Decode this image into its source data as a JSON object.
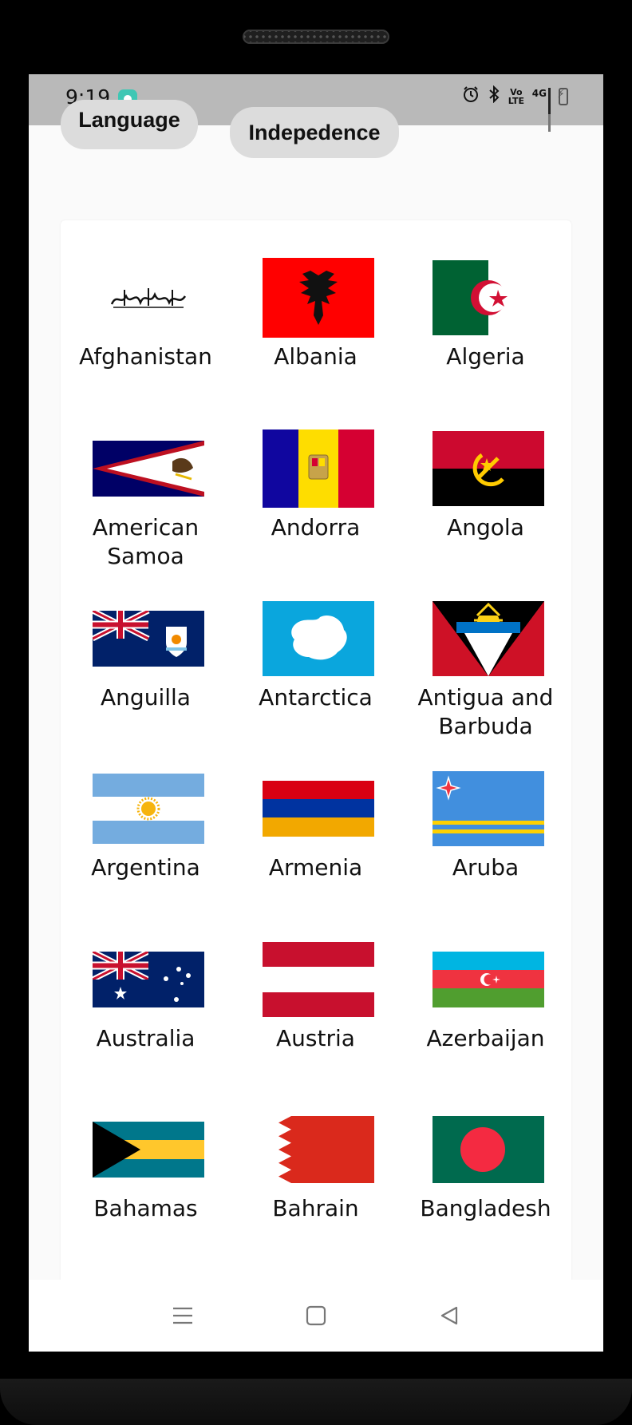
{
  "status_bar": {
    "time": "9:19",
    "icons": [
      "app-notification-icon",
      "alarm-icon",
      "bluetooth-icon",
      "volte-icon",
      "4g-signal-icon",
      "battery-charging-icon"
    ],
    "volte_text": "Vo LTE",
    "network_text": "4G"
  },
  "header": {
    "chips": [
      {
        "label": "Language"
      },
      {
        "label": "Indepedence"
      }
    ]
  },
  "countries": [
    {
      "name": "Afghanistan",
      "flag": "afghanistan-flag-icon"
    },
    {
      "name": "Albania",
      "flag": "albania-flag-icon"
    },
    {
      "name": "Algeria",
      "flag": "algeria-flag-icon"
    },
    {
      "name": "American Samoa",
      "flag": "american-samoa-flag-icon"
    },
    {
      "name": "Andorra",
      "flag": "andorra-flag-icon"
    },
    {
      "name": "Angola",
      "flag": "angola-flag-icon"
    },
    {
      "name": "Anguilla",
      "flag": "anguilla-flag-icon"
    },
    {
      "name": "Antarctica",
      "flag": "antarctica-flag-icon"
    },
    {
      "name": "Antigua and Barbuda",
      "flag": "antigua-and-barbuda-flag-icon"
    },
    {
      "name": "Argentina",
      "flag": "argentina-flag-icon"
    },
    {
      "name": "Armenia",
      "flag": "armenia-flag-icon"
    },
    {
      "name": "Aruba",
      "flag": "aruba-flag-icon"
    },
    {
      "name": "Australia",
      "flag": "australia-flag-icon"
    },
    {
      "name": "Austria",
      "flag": "austria-flag-icon"
    },
    {
      "name": "Azerbaijan",
      "flag": "azerbaijan-flag-icon"
    },
    {
      "name": "Bahamas",
      "flag": "bahamas-flag-icon"
    },
    {
      "name": "Bahrain",
      "flag": "bahrain-flag-icon"
    },
    {
      "name": "Bangladesh",
      "flag": "bangladesh-flag-icon"
    }
  ],
  "nav_bar": {
    "buttons": [
      "menu-icon",
      "home-icon",
      "back-icon"
    ]
  },
  "colors": {
    "status_bar_bg": "#b9b9b9",
    "chip_bg": "#dcdcdc",
    "screen_bg": "#fafafa",
    "card_bg": "#ffffff"
  }
}
